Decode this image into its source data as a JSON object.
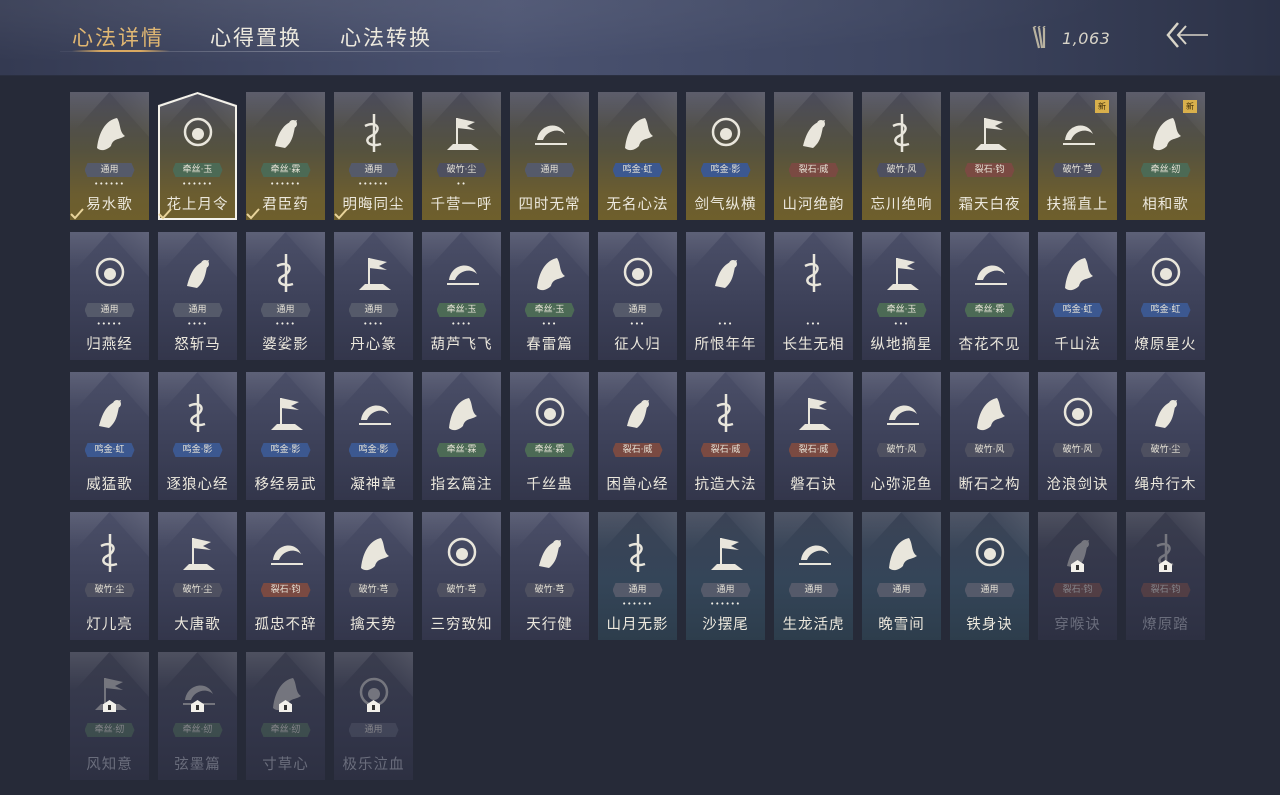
{
  "tabs": [
    {
      "label": "心法详情",
      "active": true
    },
    {
      "label": "心得置换",
      "active": false
    },
    {
      "label": "心法转换",
      "active": false
    }
  ],
  "currency": {
    "value": "1,063",
    "icon": "arrow-bundle-icon"
  },
  "badge_colors": {
    "通用": "#555a6a",
    "鸣金": "#3c5890",
    "裂石": "#7a4a42",
    "牵丝": "#4c6a55",
    "破竹": "#4e5060"
  },
  "cards": [
    {
      "name": "易水歌",
      "badge": "通用",
      "badge_type": "通用",
      "dots": "••••••",
      "style": "gold",
      "icon": "horse-icon",
      "check": true
    },
    {
      "name": "花上月令",
      "badge": "牵丝·玉",
      "badge_type": "牵丝",
      "dots": "••••••",
      "style": "selected",
      "icon": "flower-moon-icon",
      "check": true
    },
    {
      "name": "君臣药",
      "badge": "牵丝·霖",
      "badge_type": "牵丝",
      "dots": "••••••",
      "style": "gold",
      "icon": "herb-icon",
      "check": true
    },
    {
      "name": "明晦同尘",
      "badge": "通用",
      "badge_type": "通用",
      "dots": "••••••",
      "style": "gold",
      "icon": "serpent-sword-icon",
      "check": true
    },
    {
      "name": "千营一呼",
      "badge": "破竹·尘",
      "badge_type": "破竹",
      "dots": "••",
      "style": "gold",
      "icon": "banner-icon"
    },
    {
      "name": "四时无常",
      "badge": "通用",
      "badge_type": "通用",
      "dots": "",
      "style": "gold",
      "icon": "moon-mountain-icon"
    },
    {
      "name": "无名心法",
      "badge": "鸣金·虹",
      "badge_type": "鸣金",
      "dots": "",
      "style": "gold",
      "icon": "sword-icon"
    },
    {
      "name": "剑气纵横",
      "badge": "鸣金·影",
      "badge_type": "鸣金",
      "dots": "",
      "style": "gold",
      "icon": "crossed-swords-icon"
    },
    {
      "name": "山河绝韵",
      "badge": "裂石·威",
      "badge_type": "裂石",
      "dots": "",
      "style": "gold",
      "icon": "mountains-icon"
    },
    {
      "name": "忘川绝响",
      "badge": "破竹·风",
      "badge_type": "破竹",
      "dots": "",
      "style": "gold",
      "icon": "mask-icon"
    },
    {
      "name": "霜天白夜",
      "badge": "裂石·钧",
      "badge_type": "裂石",
      "dots": "",
      "style": "gold",
      "icon": "blade-icon"
    },
    {
      "name": "扶摇直上",
      "badge": "破竹·芎",
      "badge_type": "破竹",
      "dots": "",
      "style": "gold",
      "icon": "eagle-icon",
      "new": "新"
    },
    {
      "name": "相和歌",
      "badge": "牵丝·纫",
      "badge_type": "牵丝",
      "dots": "",
      "style": "gold",
      "icon": "dragon-icon",
      "new": "新"
    },
    {
      "name": "归燕经",
      "badge": "通用",
      "badge_type": "通用",
      "dots": "•••••",
      "style": "normal",
      "icon": "swallows-icon"
    },
    {
      "name": "怒斩马",
      "badge": "通用",
      "badge_type": "通用",
      "dots": "••••",
      "style": "normal",
      "icon": "glaive-icon"
    },
    {
      "name": "婆娑影",
      "badge": "通用",
      "badge_type": "通用",
      "dots": "••••",
      "style": "normal",
      "icon": "coiled-dragon-icon"
    },
    {
      "name": "丹心篆",
      "badge": "通用",
      "badge_type": "通用",
      "dots": "••••",
      "style": "normal",
      "icon": "comet-icon"
    },
    {
      "name": "葫芦飞飞",
      "badge": "牵丝·玉",
      "badge_type": "牵丝",
      "dots": "••••",
      "style": "normal",
      "icon": "gourd-icon"
    },
    {
      "name": "春雷篇",
      "badge": "牵丝·玉",
      "badge_type": "牵丝",
      "dots": "•••",
      "style": "normal",
      "icon": "storm-tree-icon"
    },
    {
      "name": "征人归",
      "badge": "通用",
      "badge_type": "通用",
      "dots": "•••",
      "style": "normal",
      "icon": "hand-bird-icon"
    },
    {
      "name": "所恨年年",
      "badge": "",
      "badge_type": "通用",
      "dots": "•••",
      "style": "normal",
      "icon": "reed-icon"
    },
    {
      "name": "长生无相",
      "badge": "",
      "badge_type": "通用",
      "dots": "•••",
      "style": "normal",
      "icon": "statue-icon"
    },
    {
      "name": "纵地摘星",
      "badge": "牵丝·玉",
      "badge_type": "牵丝",
      "dots": "•••",
      "style": "normal",
      "icon": "star-swirl-icon"
    },
    {
      "name": "杏花不见",
      "badge": "牵丝·霖",
      "badge_type": "牵丝",
      "dots": "",
      "style": "normal",
      "icon": "blossom-icon"
    },
    {
      "name": "千山法",
      "badge": "鸣金·虹",
      "badge_type": "鸣金",
      "dots": "",
      "style": "normal",
      "icon": "peaks-icon"
    },
    {
      "name": "燎原星火",
      "badge": "鸣金·虹",
      "badge_type": "鸣金",
      "dots": "",
      "style": "normal",
      "icon": "flame-arc-icon"
    },
    {
      "name": "威猛歌",
      "badge": "鸣金·虹",
      "badge_type": "鸣金",
      "dots": "",
      "style": "normal",
      "icon": "fist-icon"
    },
    {
      "name": "逐狼心经",
      "badge": "鸣金·影",
      "badge_type": "鸣金",
      "dots": "",
      "style": "normal",
      "icon": "wolf-icon"
    },
    {
      "name": "移经易武",
      "badge": "鸣金·影",
      "badge_type": "鸣金",
      "dots": "",
      "style": "normal",
      "icon": "armor-icon"
    },
    {
      "name": "凝神章",
      "badge": "鸣金·影",
      "badge_type": "鸣金",
      "dots": "",
      "style": "normal",
      "icon": "bow-icon"
    },
    {
      "name": "指玄篇注",
      "badge": "牵丝·霖",
      "badge_type": "牵丝",
      "dots": "",
      "style": "normal",
      "icon": "yin-yang-icon"
    },
    {
      "name": "千丝蛊",
      "badge": "牵丝·霖",
      "badge_type": "牵丝",
      "dots": "",
      "style": "normal",
      "icon": "leaf-icon"
    },
    {
      "name": "困兽心经",
      "badge": "裂石·威",
      "badge_type": "裂石",
      "dots": "",
      "style": "normal",
      "icon": "chained-beast-icon"
    },
    {
      "name": "抗造大法",
      "badge": "裂石·威",
      "badge_type": "裂石",
      "dots": "",
      "style": "normal",
      "icon": "bell-icon"
    },
    {
      "name": "磐石诀",
      "badge": "裂石·威",
      "badge_type": "裂石",
      "dots": "",
      "style": "normal",
      "icon": "rock-icon"
    },
    {
      "name": "心弥泥鱼",
      "badge": "破竹·风",
      "badge_type": "破竹",
      "dots": "",
      "style": "normal",
      "icon": "fish-icon"
    },
    {
      "name": "断石之构",
      "badge": "破竹·风",
      "badge_type": "破竹",
      "dots": "",
      "style": "normal",
      "icon": "warrior-icon"
    },
    {
      "name": "沧浪剑诀",
      "badge": "破竹·风",
      "badge_type": "破竹",
      "dots": "",
      "style": "normal",
      "icon": "sea-dragon-icon"
    },
    {
      "name": "绳舟行木",
      "badge": "破竹·尘",
      "badge_type": "破竹",
      "dots": "",
      "style": "normal",
      "icon": "octopus-icon"
    },
    {
      "name": "灯儿亮",
      "badge": "破竹·尘",
      "badge_type": "破竹",
      "dots": "",
      "style": "normal",
      "icon": "lantern-icon"
    },
    {
      "name": "大唐歌",
      "badge": "破竹·尘",
      "badge_type": "破竹",
      "dots": "",
      "style": "normal",
      "icon": "city-icon"
    },
    {
      "name": "孤忠不辞",
      "badge": "裂石·钧",
      "badge_type": "裂石",
      "dots": "",
      "style": "normal",
      "icon": "shattered-blade-icon"
    },
    {
      "name": "擒天势",
      "badge": "破竹·芎",
      "badge_type": "破竹",
      "dots": "",
      "style": "normal",
      "icon": "chain-fist-icon"
    },
    {
      "name": "三穷致知",
      "badge": "破竹·芎",
      "badge_type": "破竹",
      "dots": "",
      "style": "normal",
      "icon": "scroll-icon"
    },
    {
      "name": "天行健",
      "badge": "破竹·芎",
      "badge_type": "破竹",
      "dots": "",
      "style": "normal",
      "icon": "umbrella-icon"
    },
    {
      "name": "山月无影",
      "badge": "通用",
      "badge_type": "通用",
      "dots": "••••••",
      "style": "teal",
      "icon": "dagger-icon"
    },
    {
      "name": "沙摆尾",
      "badge": "通用",
      "badge_type": "通用",
      "dots": "••••••",
      "style": "teal",
      "icon": "wave-icon"
    },
    {
      "name": "生龙活虎",
      "badge": "通用",
      "badge_type": "通用",
      "dots": "",
      "style": "teal",
      "icon": "spin-icon"
    },
    {
      "name": "晚雪间",
      "badge": "通用",
      "badge_type": "通用",
      "dots": "",
      "style": "teal",
      "icon": "cross-icon"
    },
    {
      "name": "铁身诀",
      "badge": "通用",
      "badge_type": "通用",
      "dots": "",
      "style": "teal",
      "icon": "strongman-icon"
    },
    {
      "name": "穿喉诀",
      "badge": "裂石·钧",
      "badge_type": "裂石",
      "dots": "",
      "style": "locked",
      "icon": "yin-swirl-icon"
    },
    {
      "name": "燎原踏",
      "badge": "裂石·钧",
      "badge_type": "裂石",
      "dots": "",
      "style": "locked",
      "icon": "rider-icon"
    },
    {
      "name": "风知意",
      "badge": "牵丝·纫",
      "badge_type": "牵丝",
      "dots": "",
      "style": "locked",
      "icon": "crab-icon"
    },
    {
      "name": "弦墨篇",
      "badge": "牵丝·纫",
      "badge_type": "牵丝",
      "dots": "",
      "style": "locked",
      "icon": "brush-icon"
    },
    {
      "name": "寸草心",
      "badge": "牵丝·纫",
      "badge_type": "牵丝",
      "dots": "",
      "style": "locked",
      "icon": "pouch-icon"
    },
    {
      "name": "极乐泣血",
      "badge": "通用",
      "badge_type": "通用",
      "dots": "",
      "style": "locked",
      "icon": "bat-wing-icon"
    }
  ]
}
